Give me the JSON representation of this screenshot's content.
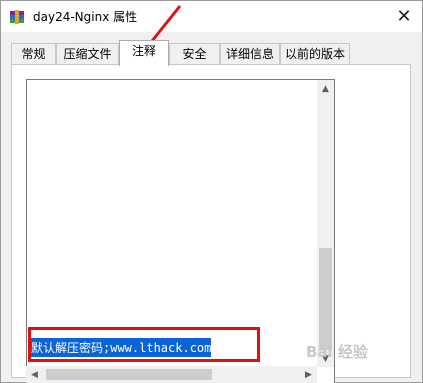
{
  "window": {
    "title": "day24-Nginx 属性",
    "close_label": "✕"
  },
  "tabs": [
    {
      "label": "常规"
    },
    {
      "label": "压缩文件"
    },
    {
      "label": "注释",
      "active": true
    },
    {
      "label": "安全"
    },
    {
      "label": "详细信息"
    },
    {
      "label": "以前的版本"
    }
  ],
  "comment": {
    "text": "默认解压密码;www.lthack.com"
  },
  "scrollbar": {
    "up_arrow": "▲",
    "down_arrow": "▼",
    "left_arrow": "◀",
    "right_arrow": "▶"
  },
  "watermark": {
    "text": "Bai 经验"
  },
  "colors": {
    "selection": "#0a64d8",
    "annotation": "#e01010",
    "panel": "#f0f0f0"
  },
  "icons": {
    "app": "winrar-archive-icon",
    "close": "close-icon",
    "annotation": "red-arrow-icon"
  }
}
